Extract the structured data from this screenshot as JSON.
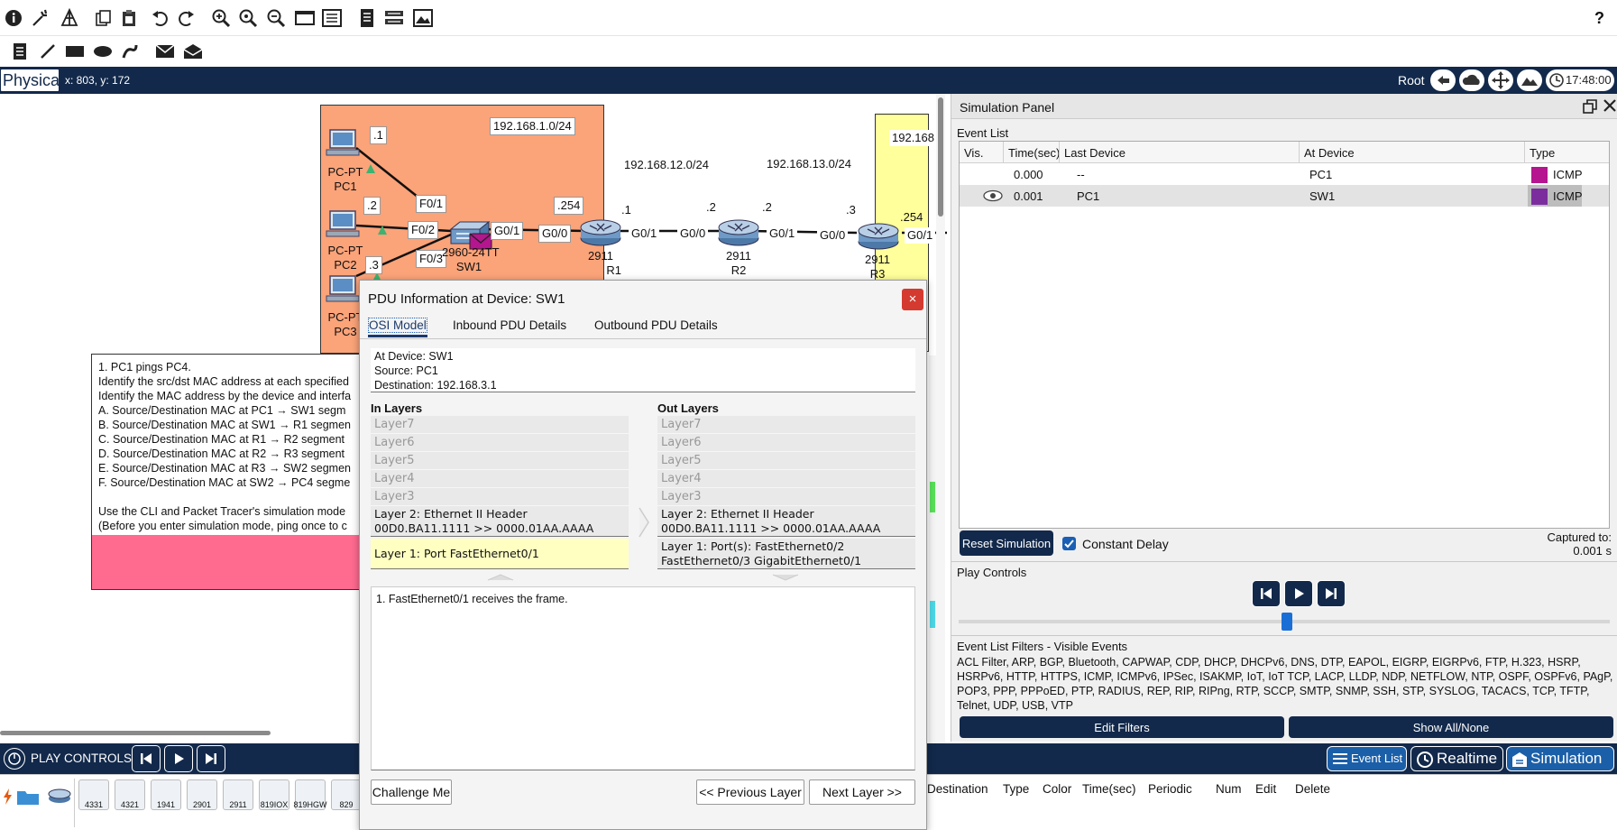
{
  "toolbar": {
    "top_icons": [
      "info-icon",
      "wizard-icon",
      "network-icon",
      "copy-icon",
      "paste-icon",
      "undo-icon",
      "redo-icon",
      "zoom-in-icon",
      "zoom-custom-icon",
      "zoom-out-icon",
      "drawing-palette-icon",
      "custom-device-icon",
      "notes-icon",
      "view-icon",
      "image-icon"
    ],
    "help_label": "?",
    "draw_icons": [
      "note-icon",
      "line-icon",
      "rectangle-icon",
      "ellipse-icon",
      "freeform-icon",
      "simple-pdu-icon",
      "complex-pdu-icon"
    ]
  },
  "nav": {
    "mode": "Physical",
    "coords": "x: 803, y: 172",
    "root": "Root",
    "time": "17:48:00"
  },
  "topology": {
    "subnet1": "192.168.1.0/24",
    "subnet12": "192.168.12.0/24",
    "subnet13": "192.168.13.0/24",
    "subnet3": "192.168",
    "pcs": [
      {
        "type": "PC-PT",
        "name": "PC1",
        "addr": ".1"
      },
      {
        "type": "PC-PT",
        "name": "PC2",
        "addr": ".2"
      },
      {
        "type": "PC-PT",
        "name": "PC3",
        "addr": ".3"
      }
    ],
    "switch": {
      "model": "2960-24TT",
      "name": "SW1"
    },
    "ports": {
      "f01": "F0/1",
      "f02": "F0/2",
      "f03": "F0/3",
      "g01_sw": "G0/1",
      "g00_r1": "G0/0",
      "g01_r1": "G0/1",
      "g00_r2": "G0/0",
      "g01_r2": "G0/1",
      "g00_r3": "G0/0",
      "g01_r3": "G0/1"
    },
    "addrs": {
      "r1_lan": ".254",
      "r1_wan": ".1",
      "r2_a": ".2",
      "r2_b": ".2",
      "r3_a": ".3",
      "r3_lan": ".254"
    },
    "routers": [
      {
        "model": "2911",
        "name": "R1"
      },
      {
        "model": "2911",
        "name": "R2"
      },
      {
        "model": "2911",
        "name": "R3"
      }
    ]
  },
  "note": {
    "lines": [
      "1. PC1 pings PC4.",
      "Identify the src/dst MAC address at each specified",
      "Identify the MAC address by the device and interfa",
      "A. Source/Destination MAC at PC1 → SW1 segm",
      "B. Source/Destination MAC at SW1 → R1 segmen",
      "C. Source/Destination MAC at R1 → R2 segment",
      "D. Source/Destination MAC at R2 → R3 segment",
      "E. Source/Destination MAC at R3 → SW2 segmen",
      "F. Source/Destination MAC at SW2 → PC4 segme",
      "",
      "Use the CLI and Packet Tracer's simulation mode",
      "(Before you enter simulation mode, ping once to c"
    ]
  },
  "sim": {
    "title": "Simulation Panel",
    "event_list_label": "Event List",
    "columns": [
      "Vis.",
      "Time(sec)",
      "Last Device",
      "At Device",
      "Type"
    ],
    "events": [
      {
        "vis": "",
        "time": "0.000",
        "last": "--",
        "at": "PC1",
        "type": "ICMP",
        "color": "#b5158f"
      },
      {
        "vis": "eye",
        "time": "0.001",
        "last": "PC1",
        "at": "SW1",
        "type": "ICMP",
        "color": "#7b2d9e"
      }
    ],
    "reset_label": "Reset Simulation",
    "constant_delay_label": "Constant Delay",
    "captured_label": "Captured to:",
    "captured_value": "0.001 s",
    "play_controls_label": "Play Controls",
    "filters_label": "Event List Filters - Visible Events",
    "filters_text": "ACL Filter, ARP, BGP, Bluetooth, CAPWAP, CDP, DHCP, DHCPv6, DNS, DTP, EAPOL, EIGRP, EIGRPv6, FTP, H.323, HSRP, HSRPv6, HTTP, HTTPS, ICMP, ICMPv6, IPSec, ISAKMP, IoT, IoT TCP, LACP, LLDP, NDP, NETFLOW, NTP, OSPF, OSPFv6, PAgP, POP3, PPP, PPPoED, PTP, RADIUS, REP, RIP, RIPng, RTP, SCCP, SMTP, SNMP, SSH, STP, SYSLOG, TACACS, TCP, TFTP, Telnet, UDP, USB, VTP",
    "edit_filters_label": "Edit Filters",
    "show_all_label": "Show All/None"
  },
  "pdu": {
    "title": "PDU Information at Device: SW1",
    "close": "×",
    "tabs": [
      "OSI Model",
      "Inbound PDU Details",
      "Outbound PDU Details"
    ],
    "at_device": "At Device: SW1",
    "source": "Source: PC1",
    "destination": "Destination: 192.168.3.1",
    "in_title": "In Layers",
    "out_title": "Out Layers",
    "in_layers": [
      "Layer7",
      "Layer6",
      "Layer5",
      "Layer4",
      "Layer3"
    ],
    "out_layers": [
      "Layer7",
      "Layer6",
      "Layer5",
      "Layer4",
      "Layer3"
    ],
    "in_l2_a": "Layer 2: Ethernet II Header",
    "in_l2_b": "00D0.BA11.1111 >> 0000.01AA.AAAA",
    "in_l1": "Layer 1: Port FastEthernet0/1",
    "out_l2_a": "Layer 2: Ethernet II Header",
    "out_l2_b": "00D0.BA11.1111 >> 0000.01AA.AAAA",
    "out_l1_a": "Layer 1: Port(s): FastEthernet0/2",
    "out_l1_b": "FastEthernet0/3 GigabitEthernet0/1",
    "description": "1. FastEthernet0/1 receives the frame.",
    "challenge": "Challenge Me",
    "prev": "<< Previous Layer",
    "next": "Next Layer >>"
  },
  "bottom": {
    "play_controls": "PLAY CONTROLS:",
    "event_list": "Event List",
    "realtime": "Realtime",
    "simulation": "Simulation"
  },
  "devices": [
    "4331",
    "4321",
    "1941",
    "2901",
    "2911",
    "819IOX",
    "819HGW",
    "829"
  ],
  "pdu_columns": [
    "Destination",
    "Type",
    "Color",
    "Time(sec)",
    "Periodic",
    "Num",
    "Edit",
    "Delete"
  ]
}
